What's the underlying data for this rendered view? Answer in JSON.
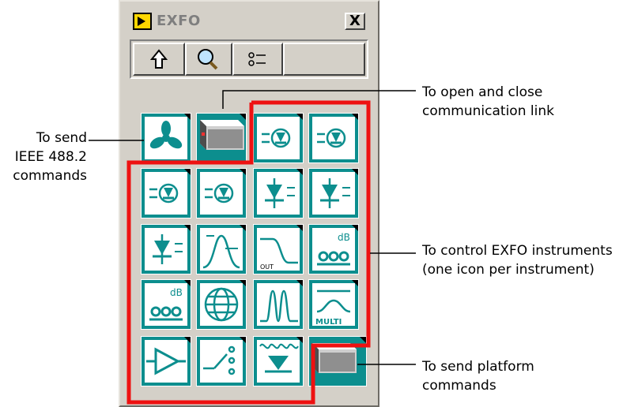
{
  "window": {
    "title": "EXFO",
    "close_label": "X"
  },
  "toolbar": {
    "buttons": [
      {
        "name": "up-arrow-icon"
      },
      {
        "name": "magnifier-icon"
      },
      {
        "name": "list-options-icon"
      }
    ]
  },
  "palette_tiles": [
    "asterisk-icon",
    "link-device-icon",
    "laser-source-icon",
    "laser-source-icon",
    "laser-source-icon",
    "laser-source-icon",
    "detector-icon",
    "detector-icon",
    "detector-icon",
    "spectrum-icon",
    "filter-curve-icon",
    "db-meter-icon",
    "db-meter-icon",
    "globe-icon",
    "multi-peak-icon",
    "multi-wavelength-icon",
    "amplifier-icon",
    "switch-icon",
    "detector-coil-icon",
    "platform-icon"
  ],
  "callouts": {
    "ieee": {
      "lines": [
        "To send",
        "IEEE 488.2",
        "commands"
      ]
    },
    "link": {
      "lines": [
        "To open and close",
        "communication link"
      ]
    },
    "instruments": {
      "lines": [
        "To control EXFO instruments",
        "(one icon per instrument)"
      ]
    },
    "platform": {
      "lines": [
        "To send platform",
        "commands"
      ]
    }
  },
  "colors": {
    "teal": "#0c8e8e",
    "highlight": "#ee1111",
    "face": "#d4d0c8"
  }
}
